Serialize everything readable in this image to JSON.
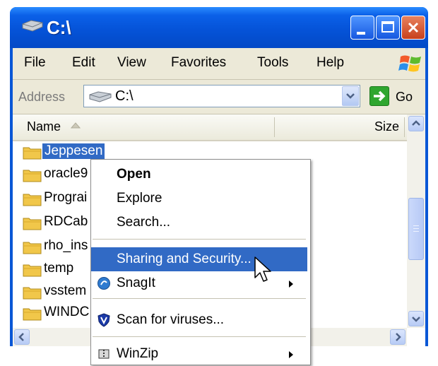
{
  "window": {
    "title": "C:\\"
  },
  "menubar": {
    "items": [
      "File",
      "Edit",
      "View",
      "Favorites",
      "Tools",
      "Help"
    ]
  },
  "address": {
    "label": "Address",
    "value": "C:\\",
    "go_label": "Go"
  },
  "columns": {
    "name": "Name",
    "size": "Size"
  },
  "files": [
    {
      "name": "Jeppesen",
      "selected": true
    },
    {
      "name": "oracle9"
    },
    {
      "name": "Prograi"
    },
    {
      "name": "RDCab"
    },
    {
      "name": "rho_ins"
    },
    {
      "name": "temp"
    },
    {
      "name": "vsstem"
    },
    {
      "name": "WINDC"
    }
  ],
  "row_type_char": "F",
  "context_menu": {
    "items": [
      {
        "label": "Open",
        "bold": true
      },
      {
        "label": "Explore"
      },
      {
        "label": "Search..."
      },
      {
        "label": "Sharing and Security...",
        "highlighted": true
      },
      {
        "label": "SnagIt",
        "submenu": true,
        "icon": "snagit-icon"
      },
      {
        "label": "Scan for viruses...",
        "icon": "shield-icon"
      },
      {
        "label": "WinZip",
        "submenu": true,
        "icon": "winzip-icon"
      }
    ]
  },
  "colors": {
    "titlebar": "#0553d8",
    "selection": "#316ac5",
    "chrome": "#ece9d8"
  }
}
